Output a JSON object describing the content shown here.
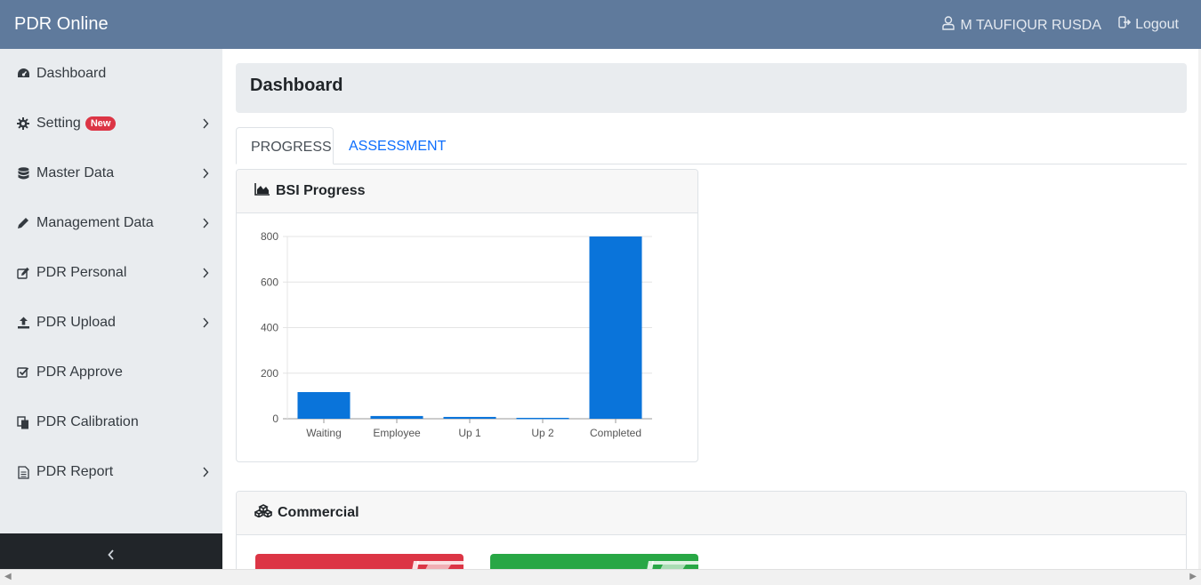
{
  "app": {
    "title": "PDR Online"
  },
  "header": {
    "user_name": "M TAUFIQUR RUSDA",
    "logout_label": "Logout"
  },
  "sidebar": {
    "items": [
      {
        "label": "Dashboard",
        "icon": "dashboard-icon",
        "has_children": false
      },
      {
        "label": "Setting",
        "icon": "gear-icon",
        "badge": "New",
        "has_children": true
      },
      {
        "label": "Master Data",
        "icon": "database-icon",
        "has_children": true
      },
      {
        "label": "Management Data",
        "icon": "pencil-icon",
        "has_children": true
      },
      {
        "label": "PDR Personal",
        "icon": "edit-icon",
        "has_children": true
      },
      {
        "label": "PDR Upload",
        "icon": "upload-icon",
        "has_children": true
      },
      {
        "label": "PDR Approve",
        "icon": "check-square-icon",
        "has_children": false
      },
      {
        "label": "PDR Calibration",
        "icon": "copy-icon",
        "has_children": false
      },
      {
        "label": "PDR Report",
        "icon": "document-icon",
        "has_children": true
      }
    ],
    "collapse_icon": "chevron-left-icon"
  },
  "page": {
    "title": "Dashboard",
    "tabs": [
      {
        "label": "PROGRESS",
        "active": true
      },
      {
        "label": "ASSESSMENT",
        "active": false
      }
    ]
  },
  "progress_card": {
    "title": "BSI Progress",
    "icon": "area-chart-icon"
  },
  "commercial_card": {
    "title": "Commercial",
    "icon": "cubes-icon"
  },
  "colors": {
    "topbar": "#5f7a9c",
    "bar": "#0a74da",
    "badge": "#dc3545",
    "tile_red": "#dc3545",
    "tile_green": "#28a745"
  },
  "chart_data": {
    "type": "bar",
    "title": "",
    "categories": [
      "Waiting",
      "Employee",
      "Up 1",
      "Up 2",
      "Completed"
    ],
    "values": [
      117,
      12,
      8,
      4,
      800
    ],
    "ylim": [
      0,
      800
    ],
    "yticks": [
      0,
      200,
      400,
      600,
      800
    ],
    "grid": true,
    "xlabel": "",
    "ylabel": ""
  }
}
